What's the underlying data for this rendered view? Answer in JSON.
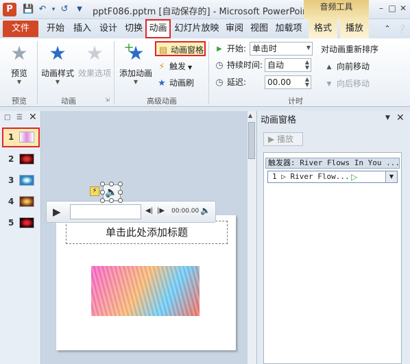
{
  "titlebar": {
    "app_icon": "P",
    "doc_title": "pptF086.pptm [自动保存的] - Microsoft PowerPoint",
    "context_tab": "音频工具",
    "qat_icons": [
      "save-icon",
      "undo-icon",
      "redo-icon",
      "customize-icon"
    ]
  },
  "tabs": {
    "file": "文件",
    "items": [
      "开始",
      "插入",
      "设计",
      "切换",
      "动画",
      "幻灯片放映",
      "审阅",
      "视图",
      "加载项",
      "格式",
      "播放"
    ]
  },
  "ribbon": {
    "preview": {
      "label": "预览",
      "group": "预览"
    },
    "animation": {
      "style_label": "动画样式",
      "effects_label": "效果选项",
      "group": "动画"
    },
    "advanced": {
      "add_label": "添加动画",
      "pane_label": "动画窗格",
      "trigger_label": "触发",
      "painter_label": "动画刷",
      "group": "高级动画"
    },
    "timing": {
      "start_label": "开始:",
      "start_value": "单击时",
      "duration_label": "持续时间:",
      "duration_value": "自动",
      "delay_label": "延迟:",
      "delay_value": "00.00",
      "reorder_label": "对动画重新排序",
      "move_earlier": "向前移动",
      "move_later": "向后移动",
      "group": "计时"
    }
  },
  "slides": {
    "numbers": [
      "1",
      "2",
      "3",
      "4",
      "5"
    ]
  },
  "player": {
    "time": "00:00.00"
  },
  "slide": {
    "title_placeholder": "单击此处添加标题"
  },
  "anim_pane": {
    "title": "动画窗格",
    "play_label": "▶ 播放",
    "trigger_header": "触发器: River Flows In You ...",
    "item": "1 ▷ River Flow..."
  },
  "colors": {
    "file_tab": "#d24726",
    "highlight": "#e0242a",
    "context_tab": "#e6c97c"
  }
}
